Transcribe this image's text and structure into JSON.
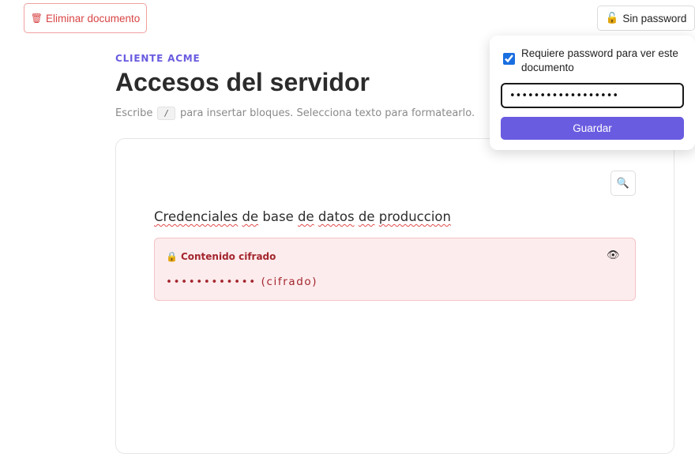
{
  "toolbar": {
    "delete_icon": "🗑",
    "delete_label": "Eliminar documento",
    "password_icon": "🔓",
    "password_label": "Sin password"
  },
  "document": {
    "client": "CLIENTE ACME",
    "title": "Accesos del servidor",
    "hint_before": "Escribe",
    "hint_key": "/",
    "hint_after": "para insertar bloques. Selecciona texto para formatearlo."
  },
  "editor": {
    "search_icon": "🔍",
    "paragraph_words": [
      "Credenciales",
      "de",
      "base",
      "de",
      "datos",
      "de",
      "produccion"
    ],
    "encrypted_block": {
      "lock_icon": "🔒",
      "label": "Contenido cifrado",
      "eye_icon": "👁",
      "value": "•••••••••••• (cifrado)"
    }
  },
  "password_popover": {
    "require_checked": true,
    "require_label": "Requiere password para ver este documento",
    "password_value": "••••••••••••••••••",
    "save_label": "Guardar"
  },
  "colors": {
    "accent": "#6a5ce0",
    "danger": "#d94444",
    "encrypted_bg": "#fdeced",
    "encrypted_text": "#a3262e"
  }
}
